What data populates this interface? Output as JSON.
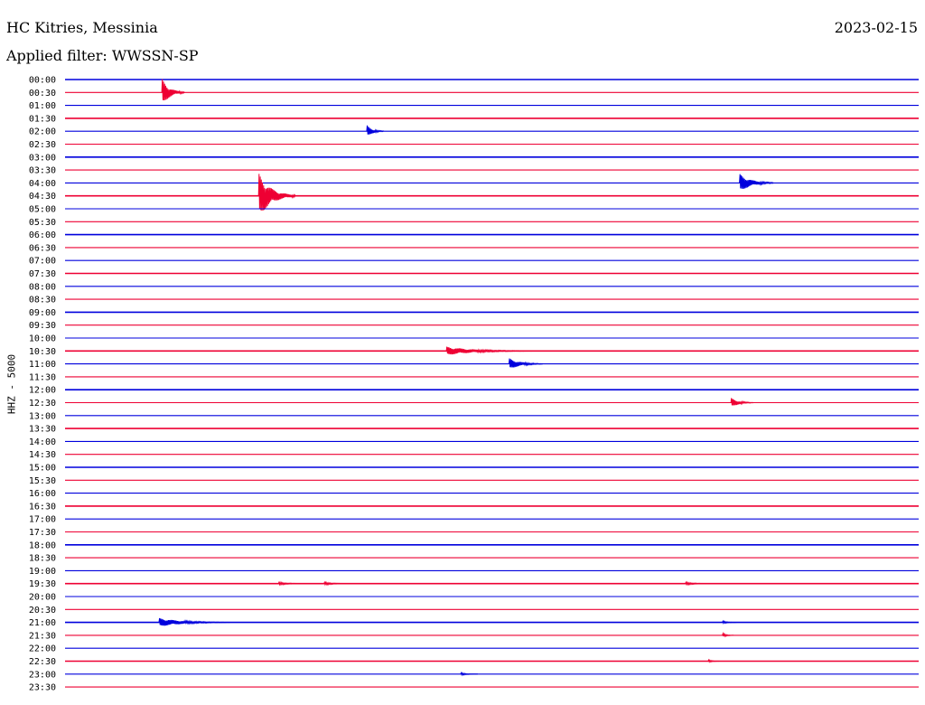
{
  "header": {
    "station": "HC Kitries, Messinia",
    "filter": "Applied filter: WWSSN-SP",
    "date": "2023-02-15"
  },
  "colors": {
    "even": "#0000dd",
    "odd": "#ee0033"
  },
  "chart_data": {
    "type": "line",
    "title": "HC Kitries, Messinia",
    "subtitle": "Applied filter: WWSSN-SP",
    "date": "2023-02-15",
    "ylabel": "HHZ - 5000",
    "x_unit": "minutes",
    "xlim": [
      0,
      30
    ],
    "rows": [
      "00:00",
      "00:30",
      "01:00",
      "01:30",
      "02:00",
      "02:30",
      "03:00",
      "03:30",
      "04:00",
      "04:30",
      "05:00",
      "05:30",
      "06:00",
      "06:30",
      "07:00",
      "07:30",
      "08:00",
      "08:30",
      "09:00",
      "09:30",
      "10:00",
      "10:30",
      "11:00",
      "11:30",
      "12:00",
      "12:30",
      "13:00",
      "13:30",
      "14:00",
      "14:30",
      "15:00",
      "15:30",
      "16:00",
      "16:30",
      "17:00",
      "17:30",
      "18:00",
      "18:30",
      "19:00",
      "19:30",
      "20:00",
      "20:30",
      "21:00",
      "21:30",
      "22:00",
      "22:30",
      "23:00",
      "23:30"
    ],
    "events": [
      {
        "row": "00:30",
        "t": 3.4,
        "amp": 2.0,
        "dur": 0.8
      },
      {
        "row": "02:00",
        "t": 10.6,
        "amp": 0.9,
        "dur": 0.6
      },
      {
        "row": "04:00",
        "t": 23.7,
        "amp": 1.3,
        "dur": 1.2
      },
      {
        "row": "04:30",
        "t": 6.8,
        "amp": 3.2,
        "dur": 1.3
      },
      {
        "row": "10:30",
        "t": 13.4,
        "amp": 0.6,
        "dur": 3.0
      },
      {
        "row": "11:00",
        "t": 15.6,
        "amp": 0.8,
        "dur": 1.2
      },
      {
        "row": "12:30",
        "t": 23.4,
        "amp": 0.7,
        "dur": 0.8
      },
      {
        "row": "19:30",
        "t": 7.5,
        "amp": 0.2,
        "dur": 1.0
      },
      {
        "row": "19:30",
        "t": 9.1,
        "amp": 0.2,
        "dur": 1.0
      },
      {
        "row": "19:30",
        "t": 21.8,
        "amp": 0.2,
        "dur": 0.9
      },
      {
        "row": "21:00",
        "t": 3.3,
        "amp": 0.6,
        "dur": 2.5
      },
      {
        "row": "21:00",
        "t": 23.1,
        "amp": 0.2,
        "dur": 0.5
      },
      {
        "row": "21:30",
        "t": 23.1,
        "amp": 0.3,
        "dur": 0.4
      },
      {
        "row": "22:30",
        "t": 22.6,
        "amp": 0.2,
        "dur": 0.4
      },
      {
        "row": "23:00",
        "t": 13.9,
        "amp": 0.2,
        "dur": 0.6
      }
    ]
  }
}
